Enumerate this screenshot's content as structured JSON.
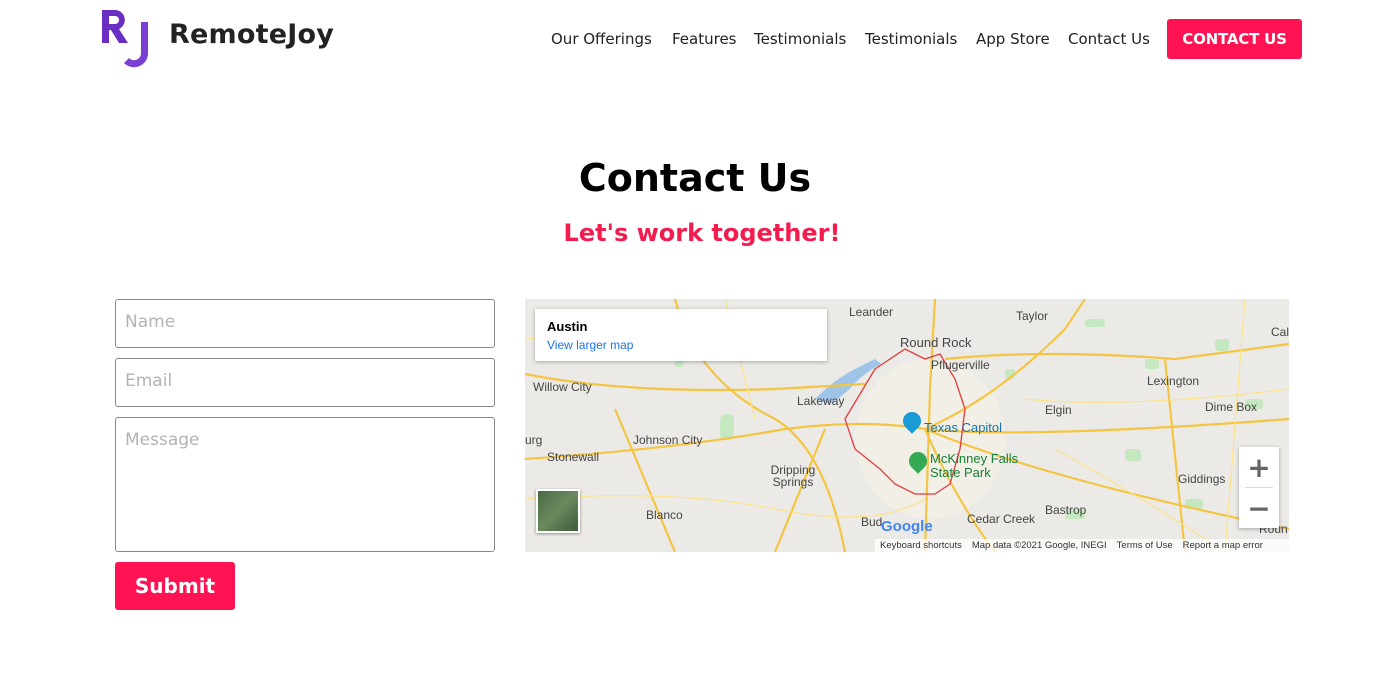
{
  "brand": {
    "name": "RemoteJoy",
    "logo_text": "RJ"
  },
  "nav": {
    "items": [
      "Our Offerings",
      "Features",
      "Testimonials",
      "Testimonials",
      "App Store",
      "Contact Us"
    ],
    "cta": "CONTACT US"
  },
  "section": {
    "title": "Contact Us",
    "subtitle": "Let's work together!"
  },
  "form": {
    "name_placeholder": "Name",
    "email_placeholder": "Email",
    "message_placeholder": "Message",
    "submit": "Submit"
  },
  "map": {
    "place": "Austin",
    "larger_link": "View larger map",
    "labels": [
      "Leander",
      "Taylor",
      "Round Rock",
      "Pflugerville",
      "Willow City",
      "Lakeway",
      "Elgin",
      "Lexington",
      "Dime Box",
      "Johnson City",
      "Stonewall",
      "Dripping Springs",
      "Blanco",
      "Cedar Creek",
      "Bastrop",
      "Giddings",
      "Texas Capitol",
      "McKinney Falls State Park",
      "Bud",
      "urg",
      "Cal",
      "Roun"
    ],
    "zoom_in": "+",
    "zoom_out": "−",
    "google": "Google",
    "footer": [
      "Keyboard shortcuts",
      "Map data ©2021 Google, INEGI",
      "Terms of Use",
      "Report a map error"
    ]
  },
  "colors": {
    "accent": "#ff1352",
    "subtitle": "#f21c4f",
    "logo": "#6a2fc2"
  }
}
